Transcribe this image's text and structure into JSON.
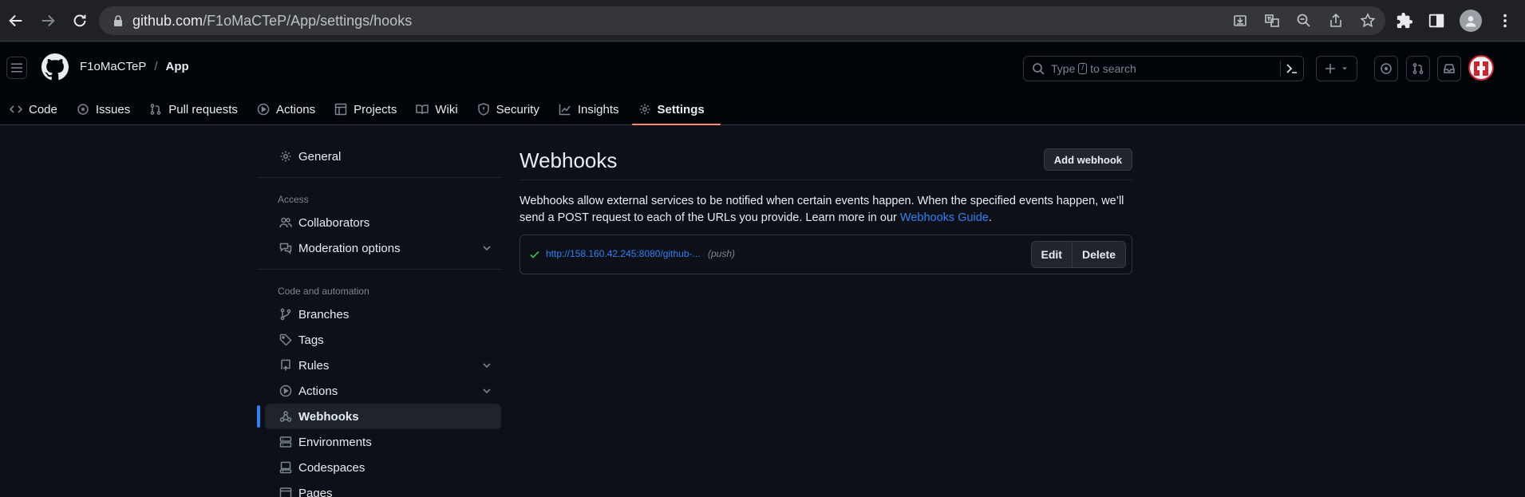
{
  "browser": {
    "url_host": "github.com",
    "url_path": "/F1oMaCTeP/App/settings/hooks"
  },
  "header": {
    "owner": "F1oMaCTeP",
    "separator": "/",
    "repo": "App",
    "search_prefix": "Type",
    "search_key": "/",
    "search_suffix": "to search"
  },
  "repo_nav": {
    "tabs": [
      {
        "label": "Code",
        "icon": "code-icon"
      },
      {
        "label": "Issues",
        "icon": "issue-icon"
      },
      {
        "label": "Pull requests",
        "icon": "pull-request-icon"
      },
      {
        "label": "Actions",
        "icon": "play-icon"
      },
      {
        "label": "Projects",
        "icon": "table-icon"
      },
      {
        "label": "Wiki",
        "icon": "book-icon"
      },
      {
        "label": "Security",
        "icon": "shield-icon"
      },
      {
        "label": "Insights",
        "icon": "graph-icon"
      },
      {
        "label": "Settings",
        "icon": "gear-icon"
      }
    ],
    "active": "Settings"
  },
  "sidebar": {
    "general": "General",
    "access_heading": "Access",
    "collaborators": "Collaborators",
    "moderation": "Moderation options",
    "code_heading": "Code and automation",
    "branches": "Branches",
    "tags": "Tags",
    "rules": "Rules",
    "actions": "Actions",
    "webhooks": "Webhooks",
    "environments": "Environments",
    "codespaces": "Codespaces",
    "pages": "Pages"
  },
  "main": {
    "title": "Webhooks",
    "add_button": "Add webhook",
    "description": "Webhooks allow external services to be notified when certain events happen. When the specified events happen, we’ll send a POST request to each of the URLs you provide. Learn more in our",
    "guide_link": "Webhooks Guide",
    "guide_suffix": ".",
    "hook": {
      "url": "http://158.160.42.245:8080/github-...",
      "events": "(push)",
      "edit_label": "Edit",
      "delete_label": "Delete"
    }
  },
  "colors": {
    "accent": "#2f81f7",
    "tab_underline": "#fd8c73",
    "success": "#3fb950"
  }
}
